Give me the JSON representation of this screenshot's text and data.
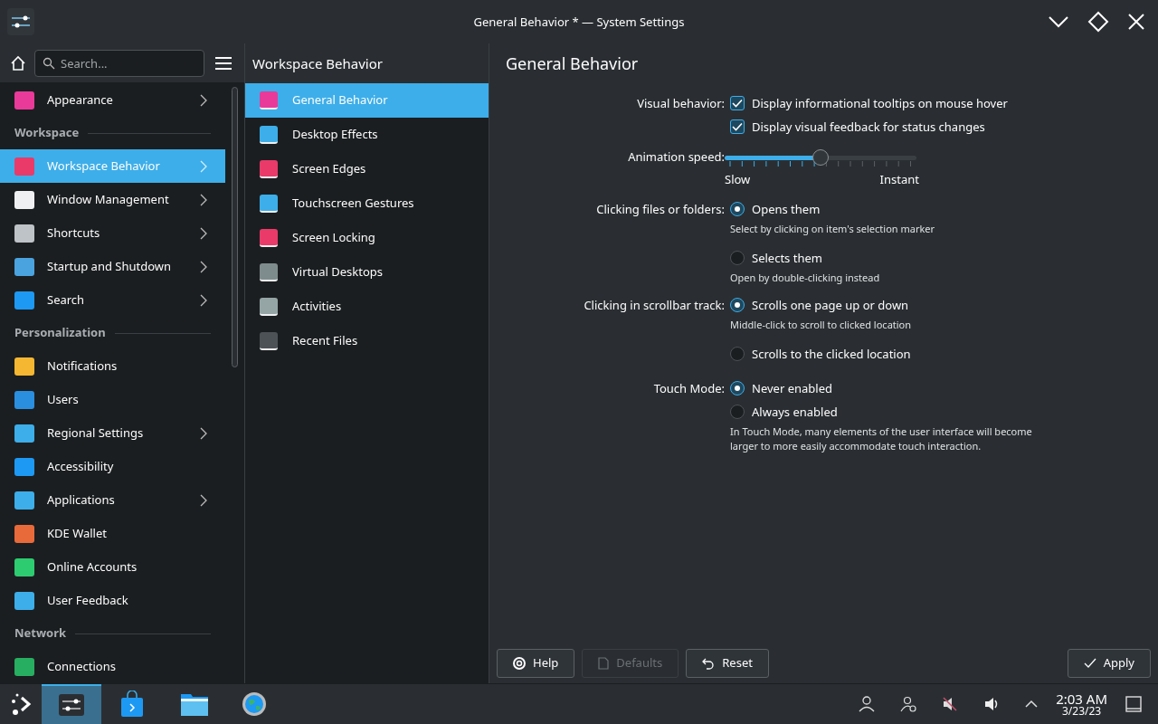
{
  "window": {
    "title": "General Behavior * — System Settings"
  },
  "sidebar": {
    "search": {
      "placeholder": "Search..."
    },
    "items": [
      {
        "kind": "item",
        "label": "Appearance",
        "has_children": true,
        "selected": false
      },
      {
        "kind": "header",
        "label": "Workspace"
      },
      {
        "kind": "item",
        "label": "Workspace Behavior",
        "has_children": true,
        "selected": true
      },
      {
        "kind": "item",
        "label": "Window Management",
        "has_children": true,
        "selected": false
      },
      {
        "kind": "item",
        "label": "Shortcuts",
        "has_children": true,
        "selected": false
      },
      {
        "kind": "item",
        "label": "Startup and Shutdown",
        "has_children": true,
        "selected": false
      },
      {
        "kind": "item",
        "label": "Search",
        "has_children": true,
        "selected": false
      },
      {
        "kind": "header",
        "label": "Personalization"
      },
      {
        "kind": "item",
        "label": "Notifications",
        "has_children": false,
        "selected": false
      },
      {
        "kind": "item",
        "label": "Users",
        "has_children": false,
        "selected": false
      },
      {
        "kind": "item",
        "label": "Regional Settings",
        "has_children": true,
        "selected": false
      },
      {
        "kind": "item",
        "label": "Accessibility",
        "has_children": false,
        "selected": false
      },
      {
        "kind": "item",
        "label": "Applications",
        "has_children": true,
        "selected": false
      },
      {
        "kind": "item",
        "label": "KDE Wallet",
        "has_children": false,
        "selected": false
      },
      {
        "kind": "item",
        "label": "Online Accounts",
        "has_children": false,
        "selected": false
      },
      {
        "kind": "item",
        "label": "User Feedback",
        "has_children": false,
        "selected": false
      },
      {
        "kind": "header",
        "label": "Network"
      },
      {
        "kind": "item",
        "label": "Connections",
        "has_children": false,
        "selected": false
      }
    ]
  },
  "subpanel": {
    "title": "Workspace Behavior",
    "items": [
      {
        "label": "General Behavior",
        "selected": true
      },
      {
        "label": "Desktop Effects",
        "selected": false
      },
      {
        "label": "Screen Edges",
        "selected": false
      },
      {
        "label": "Touchscreen Gestures",
        "selected": false
      },
      {
        "label": "Screen Locking",
        "selected": false
      },
      {
        "label": "Virtual Desktops",
        "selected": false
      },
      {
        "label": "Activities",
        "selected": false
      },
      {
        "label": "Recent Files",
        "selected": false
      }
    ]
  },
  "content": {
    "title": "General Behavior",
    "rows": [
      {
        "kind": "checkbox",
        "label": "Visual behavior:",
        "text": "Display informational tooltips on mouse hover",
        "checked": true
      },
      {
        "kind": "checkbox",
        "text": "Display visual feedback for status changes",
        "checked": true
      },
      {
        "kind": "slider",
        "label": "Animation speed:",
        "level": 0.5,
        "min_label": "Slow",
        "max_label": "Instant"
      },
      {
        "kind": "radio",
        "label": "Clicking files or folders:",
        "text": "Opens them",
        "hint": "Select by clicking on item's selection marker",
        "selected": true
      },
      {
        "kind": "radio",
        "text": "Selects them",
        "hint": "Open by double-clicking instead",
        "selected": false
      },
      {
        "kind": "radio",
        "label": "Clicking in scrollbar track:",
        "text": "Scrolls one page up or down",
        "hint": "Middle-click to scroll to clicked location",
        "selected": true
      },
      {
        "kind": "radio",
        "text": "Scrolls to the clicked location",
        "selected": false
      },
      {
        "kind": "radio",
        "label": "Touch Mode:",
        "text": "Never enabled",
        "selected": true
      },
      {
        "kind": "radio",
        "text": "Always enabled",
        "hint": "In Touch Mode, many elements of the user interface will become larger to more easily accommodate touch interaction.",
        "selected": false
      }
    ]
  },
  "buttons": [
    {
      "kind": "help",
      "label": "Help",
      "disabled": false
    },
    {
      "kind": "defaults",
      "label": "Defaults",
      "disabled": true
    },
    {
      "kind": "reset",
      "label": "Reset",
      "disabled": false
    },
    {
      "kind": "apply",
      "label": "Apply",
      "disabled": false
    }
  ],
  "taskbar": {
    "time": "2:03 AM",
    "date": "3/23/23"
  }
}
